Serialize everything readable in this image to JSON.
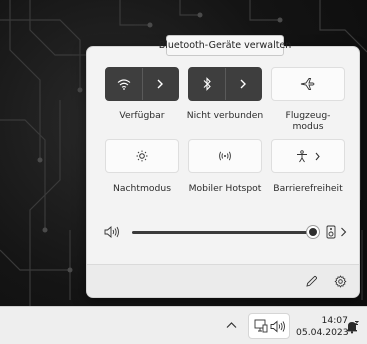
{
  "tooltip": {
    "text": "Bluetooth-Geräte verwalten"
  },
  "quick_settings": {
    "tiles": [
      {
        "id": "wifi",
        "label": "Verfügbar",
        "icon": "wifi-icon",
        "state": "on"
      },
      {
        "id": "bluetooth",
        "label": "Nicht verbunden",
        "icon": "bluetooth-icon",
        "state": "on"
      },
      {
        "id": "airplane",
        "label": "Flugzeug-\nmodus",
        "icon": "airplane-icon",
        "state": "off"
      },
      {
        "id": "night",
        "label": "Nachtmodus",
        "icon": "night-light-icon",
        "state": "off"
      },
      {
        "id": "hotspot",
        "label": "Mobiler Hotspot",
        "icon": "hotspot-icon",
        "state": "off"
      },
      {
        "id": "accessibility",
        "label": "Barrierefreiheit",
        "icon": "accessibility-icon",
        "state": "off"
      }
    ],
    "volume": {
      "level": 100,
      "icon": "speaker-icon",
      "output_icon": "audio-output-icon"
    },
    "footer": {
      "edit_icon": "pencil-icon",
      "settings_icon": "gear-icon"
    }
  },
  "taskbar": {
    "clock_time": "14:07",
    "clock_date": "05.04.2023",
    "icons": [
      "chevron-up-icon",
      "network-icon",
      "speaker-icon",
      "notification-bell-icon"
    ]
  },
  "colors": {
    "tile_on": "#3e3e3e",
    "tile_off": "#fbfbfb",
    "panel_bg": "#f3f3f3",
    "taskbar_bg": "#eeeeee"
  }
}
